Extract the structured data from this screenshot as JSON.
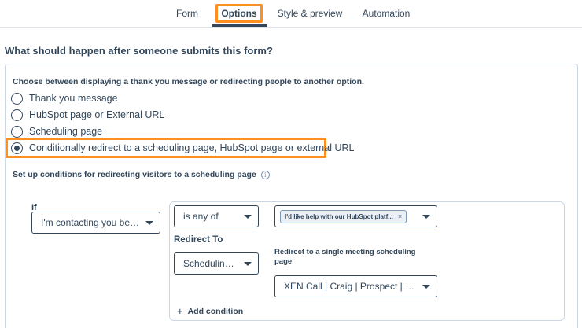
{
  "tabs": [
    {
      "label": "Form"
    },
    {
      "label": "Options"
    },
    {
      "label": "Style & preview"
    },
    {
      "label": "Automation"
    }
  ],
  "active_tab": "Options",
  "colors": {
    "highlight": "#ff8f1f",
    "text": "#33475b",
    "border": "#cbd6e2"
  },
  "heading": "What should happen after someone submits this form?",
  "choose_label": "Choose between displaying a thank you message or redirecting people to another option.",
  "radio_options": [
    {
      "label": "Thank you message",
      "checked": false
    },
    {
      "label": "HubSpot page or External URL",
      "checked": false
    },
    {
      "label": "Scheduling page",
      "checked": false
    },
    {
      "label": "Conditionally redirect to a scheduling page, HubSpot page or external URL",
      "checked": true
    }
  ],
  "setup_label": "Set up conditions for redirecting visitors to a scheduling page",
  "info_icon": "i",
  "condition": {
    "if_label": "If",
    "if_value": "I'm contacting you beca...",
    "operator": "is any of",
    "value_chip": "I'd like help with our HubSpot platf...",
    "chip_remove": "×",
    "redirect_to_label": "Redirect To",
    "redirect_to_value": "Scheduling p...",
    "redirect_single_label": "Redirect to a single meeting scheduling page",
    "meeting_value": "XEN Call | Craig | Prospect | Micro...",
    "add_condition": "Add condition",
    "add_icon": "+"
  }
}
